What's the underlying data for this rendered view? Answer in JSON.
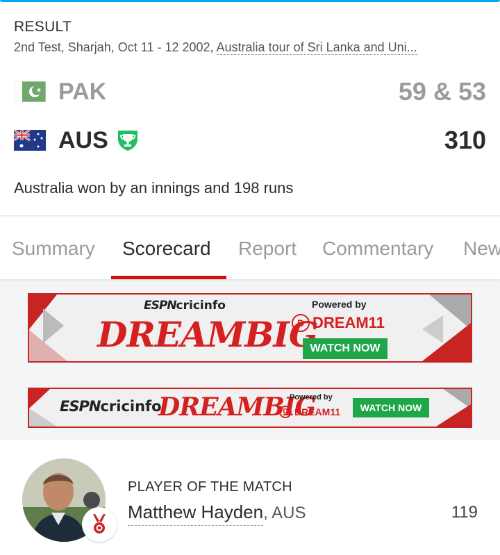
{
  "match": {
    "status": "RESULT",
    "info_prefix": "2nd Test, Sharjah, Oct 11 - 12 2002, ",
    "series": "Australia tour of Sri Lanka and Uni..."
  },
  "teams": [
    {
      "abbr": "PAK",
      "score": "59 & 53",
      "winner": false,
      "flag_icon": "pakistan-flag-icon"
    },
    {
      "abbr": "AUS",
      "score": "310",
      "winner": true,
      "flag_icon": "australia-flag-icon"
    }
  ],
  "result_text": "Australia won by an innings and 198 runs",
  "tabs": [
    {
      "label": "Summary",
      "active": false
    },
    {
      "label": "Scorecard",
      "active": true
    },
    {
      "label": "Report",
      "active": false
    },
    {
      "label": "Commentary",
      "active": false
    },
    {
      "label": "News",
      "active": false
    }
  ],
  "banners": [
    {
      "brand": "cricinfo",
      "brand_prefix": "ESPN",
      "slogan": "DREAMBIG",
      "powered_by": "Powered by",
      "sponsor": "DREAM11",
      "cta": "WATCH NOW"
    },
    {
      "brand": "cricinfo",
      "brand_prefix": "ESPN",
      "slogan": "DREAMBIG",
      "powered_by": "Powered by",
      "sponsor": "DREAM11",
      "cta": "WATCH NOW"
    }
  ],
  "player_of_match": {
    "label": "PLAYER OF THE MATCH",
    "name": "Matthew Hayden",
    "team": ", AUS",
    "score": "119"
  },
  "colors": {
    "accent_red": "#d11111",
    "winner_green": "#1fbf5f",
    "cta_green": "#1fa648",
    "muted_text": "#9b9b9b"
  }
}
